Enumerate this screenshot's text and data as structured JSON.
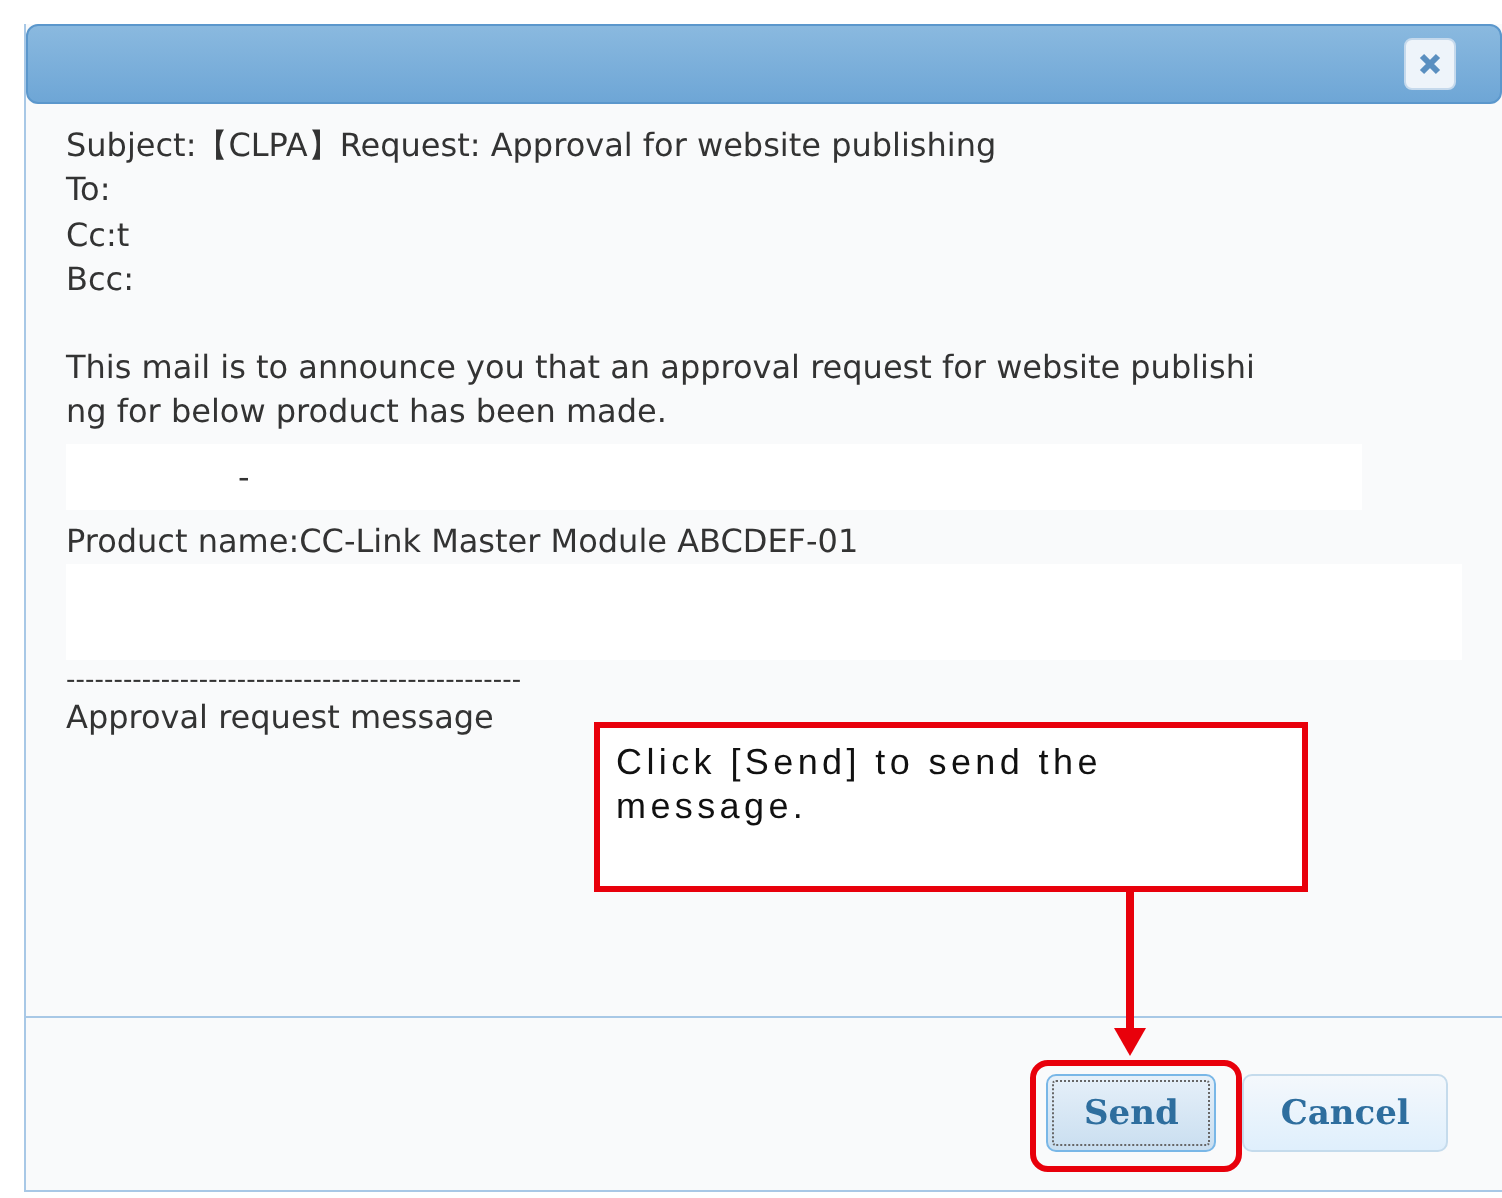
{
  "dialog": {
    "header_lines": [
      "Subject:【CLPA】Request: Approval for website publishing",
      "To:",
      "Cc:t",
      "Bcc:"
    ],
    "body_lines": [
      "This mail is to announce you that an approval request for website publishi",
      "ng for below product has been made."
    ],
    "mark": "-",
    "product": "Product name:CC-Link Master Module ABCDEF-01",
    "separator": "------------------------------------------------",
    "message_label": "Approval request message",
    "buttons": [
      {
        "label": "Send",
        "focused": true
      },
      {
        "label": "Cancel",
        "focused": false
      }
    ]
  },
  "annotation": {
    "text": "Click [Send] to send the message."
  }
}
